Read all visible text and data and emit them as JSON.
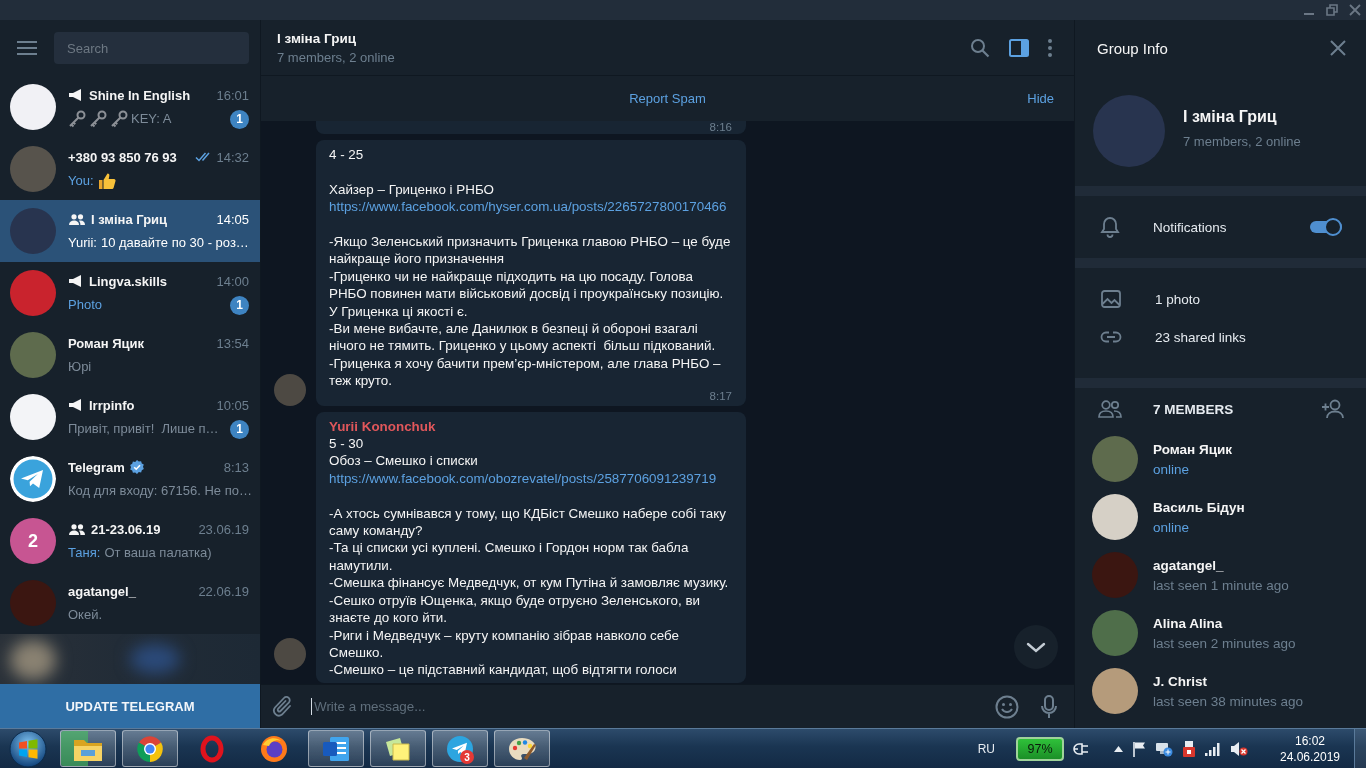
{
  "sidebar": {
    "search": {
      "placeholder": "Search"
    },
    "chats": [
      {
        "name": "Shine In English",
        "kind": "channel",
        "verified": false,
        "time": "16:01",
        "read": false,
        "preview": [
          {
            "kind": "key"
          },
          {
            "kind": "key"
          },
          {
            "kind": "key"
          },
          {
            "kind": "text",
            "text": "KEY: A"
          }
        ],
        "unread": "1",
        "selected": false,
        "avatar": {
          "kind": "photo",
          "color": "#f1f1f5"
        }
      },
      {
        "name": "+380 93 850 76 93",
        "kind": "user",
        "verified": false,
        "time": "14:32",
        "read": true,
        "preview": [
          {
            "kind": "sender",
            "text": "You:"
          },
          {
            "kind": "thumb"
          }
        ],
        "selected": false,
        "avatar": {
          "kind": "photo",
          "color": "#57534c"
        }
      },
      {
        "name": "І зміна Гриц",
        "kind": "group",
        "verified": false,
        "time": "14:05",
        "read": false,
        "preview": [
          {
            "kind": "sender",
            "text": "Yurii:"
          },
          {
            "kind": "text",
            "text": "10 давайте по 30 - роз…"
          }
        ],
        "selected": true,
        "avatar": {
          "kind": "photo",
          "color": "#28344f"
        }
      },
      {
        "name": "Lingva.skills",
        "kind": "channel",
        "verified": false,
        "time": "14:00",
        "read": false,
        "preview": [
          {
            "kind": "media",
            "text": "Photo"
          }
        ],
        "unread": "1",
        "selected": false,
        "avatar": {
          "kind": "photo",
          "color": "#c9232d"
        }
      },
      {
        "name": "Роман Яцик",
        "kind": "user",
        "verified": false,
        "time": "13:54",
        "read": false,
        "preview": [
          {
            "kind": "text",
            "text": "Юрі"
          }
        ],
        "selected": false,
        "avatar": {
          "kind": "photo",
          "color": "#5e6b4d"
        }
      },
      {
        "name": "Irrpinfo",
        "kind": "channel",
        "verified": false,
        "time": "10:05",
        "read": false,
        "preview": [
          {
            "kind": "text",
            "text": "Привіт, привіт!  Лише п…"
          }
        ],
        "unread": "1",
        "selected": false,
        "avatar": {
          "kind": "photo",
          "color": "#f3f4f7"
        }
      },
      {
        "name": "Telegram",
        "kind": "user",
        "verified": true,
        "time": "8:13",
        "read": false,
        "preview": [
          {
            "kind": "text",
            "text": "Код для входу: 67156. Не по…"
          }
        ],
        "selected": false,
        "avatar": {
          "kind": "plane"
        }
      },
      {
        "name": "21-23.06.19",
        "kind": "group",
        "verified": false,
        "time": "23.06.19",
        "read": false,
        "preview": [
          {
            "kind": "sender",
            "text": "Таня:"
          },
          {
            "kind": "text",
            "text": "От ваша палатка)"
          }
        ],
        "selected": false,
        "avatar": {
          "kind": "letter",
          "text": "2",
          "color": "#c75592"
        }
      },
      {
        "name": "agatangel_",
        "kind": "user",
        "verified": false,
        "time": "22.06.19",
        "read": false,
        "preview": [
          {
            "kind": "text",
            "text": "Окей."
          }
        ],
        "selected": false,
        "avatar": {
          "kind": "photo",
          "color": "#3b1611"
        }
      }
    ],
    "update_button": "UPDATE TELEGRAM"
  },
  "chat": {
    "title": "І зміна Гриц",
    "subtitle": "7 members, 2 online",
    "panel_button_active": true,
    "report_spam": "Report Spam",
    "hide": "Hide",
    "messages": [
      {
        "time": "8:16"
      },
      {
        "avatar": {
          "color": "#4d4943"
        },
        "groups": [
          [
            {
              "kind": "text",
              "text": "4 - 25"
            }
          ],
          [
            {
              "kind": "text",
              "text": "Хайзер – Гриценко і РНБО"
            },
            {
              "kind": "link",
              "text": "https://www.facebook.com/hyser.com.ua/posts/2265727800170466"
            }
          ],
          [
            {
              "kind": "text",
              "text": "-Якщо Зеленський призначить Гриценка главою РНБО – це буде найкраще його призначення"
            },
            {
              "kind": "text",
              "text": "-Гриценко чи не найкраще підходить на цю посаду. Голова РНБО повинен мати військовий досвід і проукраїнську позицію. У Гриценка ці якості є."
            },
            {
              "kind": "text",
              "text": "-Ви мене вибачте, але Данилюк в безпеці й обороні взагалі нічого не тямить. Гриценко у цьому аспекті  більш підкований."
            },
            {
              "kind": "text",
              "text": "-Гриценка я хочу бачити прем’єр-мністером, але глава РНБО – теж круто."
            }
          ]
        ],
        "time": "8:17"
      },
      {
        "avatar": {
          "color": "#4d4943"
        },
        "sender": {
          "name": "Yurii Kononchuk",
          "color": "#e0575b"
        },
        "groups": [
          [
            {
              "kind": "text",
              "text": "5 - 30"
            },
            {
              "kind": "text",
              "text": "Обоз – Смешко і списки"
            },
            {
              "kind": "link",
              "text": "https://www.facebook.com/obozrevatel/posts/2587706091239719"
            }
          ],
          [
            {
              "kind": "text",
              "text": "-А хтось сумнівався у тому, що КДБіст Смешко набере собі таку саму команду?"
            },
            {
              "kind": "text",
              "text": "-Та ці списки усі куплені. Смешко і Гордон норм так бабла намутили."
            },
            {
              "kind": "text",
              "text": "-Смешка фінансує Медведчук, от кум Путіна й замовляє музику."
            },
            {
              "kind": "text",
              "text": "-Сешко отруїв Ющенка, якщо буде отруєно Зеленського, ви знаєте до кого йти."
            },
            {
              "kind": "text",
              "text": "-Риги і Медведчук – круту компанію зібрав навколо себе Смешко."
            },
            {
              "kind": "text",
              "text": "-Смешко – це підставний кандидат, щоб відтягти голоси"
            }
          ]
        ]
      }
    ],
    "input": {
      "placeholder": "Write a message..."
    }
  },
  "info_panel": {
    "title": "Group Info",
    "avatar": {
      "color": "#28344f"
    },
    "name": "І зміна Гриц",
    "subtitle": "7 members, 2 online",
    "notifications": {
      "label": "Notifications",
      "on": true
    },
    "media": [
      {
        "kind": "photo",
        "label": "1 photo"
      },
      {
        "kind": "link",
        "label": "23 shared links"
      }
    ],
    "members_title": "7 MEMBERS",
    "members": [
      {
        "name": "Роман Яцик",
        "status": "online",
        "online": true,
        "avatar": {
          "color": "#5e6b4d"
        }
      },
      {
        "name": "Василь Бідун",
        "status": "online",
        "online": true,
        "avatar": {
          "color": "#d6d0c6"
        }
      },
      {
        "name": "agatangel_",
        "status": "last seen 1 minute ago",
        "online": false,
        "avatar": {
          "color": "#3b1611"
        }
      },
      {
        "name": "Alina Alina",
        "status": "last seen 2 minutes ago",
        "online": false,
        "avatar": {
          "color": "#4f6e4a"
        }
      },
      {
        "name": "J. Christ",
        "status": "last seen 38 minutes ago",
        "online": false,
        "avatar": {
          "color": "#b59b7b"
        }
      }
    ]
  },
  "taskbar": {
    "apps": [
      {
        "kind": "folder",
        "running": true,
        "level": 0.5
      },
      {
        "kind": "wheel",
        "running": true
      },
      {
        "kind": "ring",
        "running": false
      },
      {
        "kind": "globe",
        "running": false
      },
      {
        "kind": "document",
        "running": true
      },
      {
        "kind": "notes",
        "running": true
      },
      {
        "kind": "plane",
        "running": true,
        "badge": "3"
      },
      {
        "kind": "palette",
        "running": true
      }
    ],
    "language": "RU",
    "battery": "97%",
    "time": "16:02",
    "date": "24.06.2019"
  }
}
